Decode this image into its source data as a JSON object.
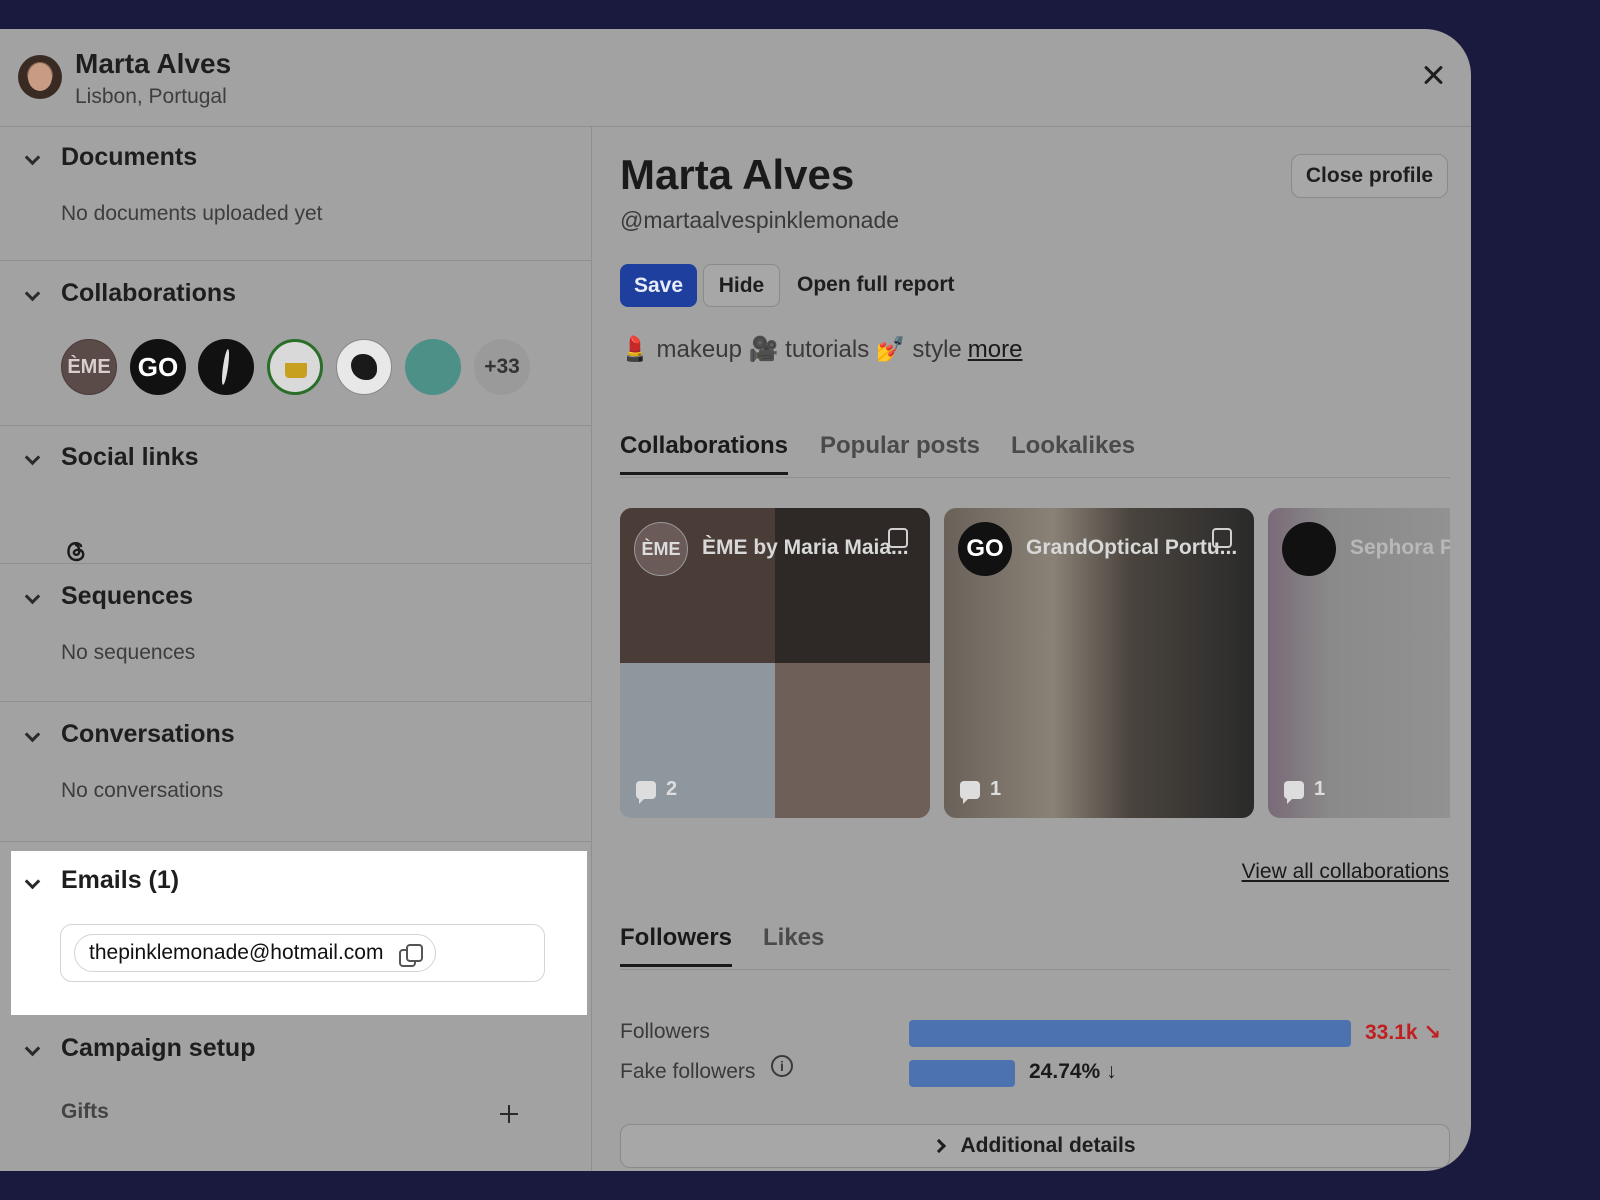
{
  "header": {
    "name": "Marta Alves",
    "location": "Lisbon, Portugal"
  },
  "left": {
    "documents": {
      "title": "Documents",
      "empty": "No documents uploaded yet"
    },
    "collaborations": {
      "title": "Collaborations",
      "logos": [
        "ÈME",
        "GO"
      ],
      "more": "+33"
    },
    "social_links": {
      "title": "Social links",
      "icons": [
        "threads-icon"
      ]
    },
    "sequences": {
      "title": "Sequences",
      "empty": "No sequences"
    },
    "conversations": {
      "title": "Conversations",
      "empty": "No conversations"
    },
    "emails": {
      "title": "Emails (1)",
      "items": [
        "thepinklemonade@hotmail.com"
      ]
    },
    "campaign": {
      "title": "Campaign setup",
      "gifts": "Gifts"
    }
  },
  "profile": {
    "name": "Marta Alves",
    "handle": "@martaalvespinklemonade",
    "close_label": "Close profile",
    "save_label": "Save",
    "hide_label": "Hide",
    "report_label": "Open full report",
    "bio": "💄 makeup 🎥 tutorials 💅 style",
    "bio_more": "more",
    "tabs": [
      "Collaborations",
      "Popular posts",
      "Lookalikes"
    ],
    "cards": [
      {
        "logo": "ÈME",
        "title": "ÈME by Maria Maia...",
        "comments": "2"
      },
      {
        "logo": "GO",
        "title": "GrandOptical Portu...",
        "comments": "1"
      },
      {
        "title": "Sephora P",
        "comments": "1"
      }
    ],
    "view_all": "View all collaborations",
    "stats_tabs": [
      "Followers",
      "Likes"
    ],
    "metrics": [
      {
        "label": "Followers",
        "value": "33.1k",
        "bar_fraction": 1.0,
        "trend": "down",
        "color": "#c01f1f"
      },
      {
        "label": "Fake followers",
        "value": "24.74%",
        "bar_fraction": 0.24,
        "trend": "down",
        "color": "#1a1a1a"
      }
    ],
    "additional": "Additional details"
  },
  "colors": {
    "save": "#1f3f9e",
    "bar": "#4d72b0",
    "background": "#1a1a3e"
  }
}
